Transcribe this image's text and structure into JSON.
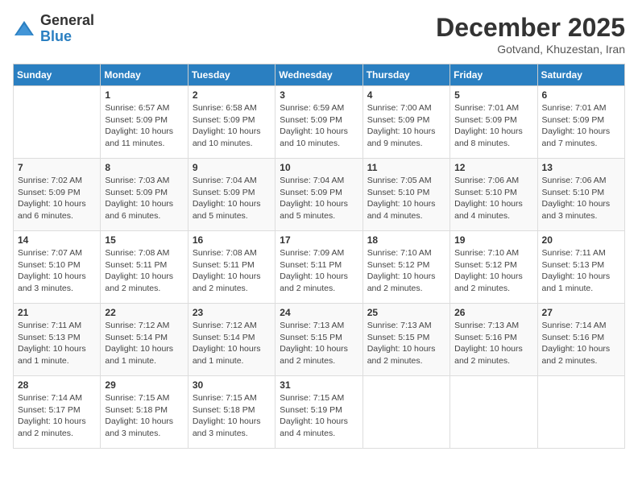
{
  "logo": {
    "general": "General",
    "blue": "Blue"
  },
  "header": {
    "month": "December 2025",
    "location": "Gotvand, Khuzestan, Iran"
  },
  "weekdays": [
    "Sunday",
    "Monday",
    "Tuesday",
    "Wednesday",
    "Thursday",
    "Friday",
    "Saturday"
  ],
  "weeks": [
    [
      {
        "day": "",
        "info": ""
      },
      {
        "day": "1",
        "info": "Sunrise: 6:57 AM\nSunset: 5:09 PM\nDaylight: 10 hours\nand 11 minutes."
      },
      {
        "day": "2",
        "info": "Sunrise: 6:58 AM\nSunset: 5:09 PM\nDaylight: 10 hours\nand 10 minutes."
      },
      {
        "day": "3",
        "info": "Sunrise: 6:59 AM\nSunset: 5:09 PM\nDaylight: 10 hours\nand 10 minutes."
      },
      {
        "day": "4",
        "info": "Sunrise: 7:00 AM\nSunset: 5:09 PM\nDaylight: 10 hours\nand 9 minutes."
      },
      {
        "day": "5",
        "info": "Sunrise: 7:01 AM\nSunset: 5:09 PM\nDaylight: 10 hours\nand 8 minutes."
      },
      {
        "day": "6",
        "info": "Sunrise: 7:01 AM\nSunset: 5:09 PM\nDaylight: 10 hours\nand 7 minutes."
      }
    ],
    [
      {
        "day": "7",
        "info": "Sunrise: 7:02 AM\nSunset: 5:09 PM\nDaylight: 10 hours\nand 6 minutes."
      },
      {
        "day": "8",
        "info": "Sunrise: 7:03 AM\nSunset: 5:09 PM\nDaylight: 10 hours\nand 6 minutes."
      },
      {
        "day": "9",
        "info": "Sunrise: 7:04 AM\nSunset: 5:09 PM\nDaylight: 10 hours\nand 5 minutes."
      },
      {
        "day": "10",
        "info": "Sunrise: 7:04 AM\nSunset: 5:09 PM\nDaylight: 10 hours\nand 5 minutes."
      },
      {
        "day": "11",
        "info": "Sunrise: 7:05 AM\nSunset: 5:10 PM\nDaylight: 10 hours\nand 4 minutes."
      },
      {
        "day": "12",
        "info": "Sunrise: 7:06 AM\nSunset: 5:10 PM\nDaylight: 10 hours\nand 4 minutes."
      },
      {
        "day": "13",
        "info": "Sunrise: 7:06 AM\nSunset: 5:10 PM\nDaylight: 10 hours\nand 3 minutes."
      }
    ],
    [
      {
        "day": "14",
        "info": "Sunrise: 7:07 AM\nSunset: 5:10 PM\nDaylight: 10 hours\nand 3 minutes."
      },
      {
        "day": "15",
        "info": "Sunrise: 7:08 AM\nSunset: 5:11 PM\nDaylight: 10 hours\nand 2 minutes."
      },
      {
        "day": "16",
        "info": "Sunrise: 7:08 AM\nSunset: 5:11 PM\nDaylight: 10 hours\nand 2 minutes."
      },
      {
        "day": "17",
        "info": "Sunrise: 7:09 AM\nSunset: 5:11 PM\nDaylight: 10 hours\nand 2 minutes."
      },
      {
        "day": "18",
        "info": "Sunrise: 7:10 AM\nSunset: 5:12 PM\nDaylight: 10 hours\nand 2 minutes."
      },
      {
        "day": "19",
        "info": "Sunrise: 7:10 AM\nSunset: 5:12 PM\nDaylight: 10 hours\nand 2 minutes."
      },
      {
        "day": "20",
        "info": "Sunrise: 7:11 AM\nSunset: 5:13 PM\nDaylight: 10 hours\nand 1 minute."
      }
    ],
    [
      {
        "day": "21",
        "info": "Sunrise: 7:11 AM\nSunset: 5:13 PM\nDaylight: 10 hours\nand 1 minute."
      },
      {
        "day": "22",
        "info": "Sunrise: 7:12 AM\nSunset: 5:14 PM\nDaylight: 10 hours\nand 1 minute."
      },
      {
        "day": "23",
        "info": "Sunrise: 7:12 AM\nSunset: 5:14 PM\nDaylight: 10 hours\nand 1 minute."
      },
      {
        "day": "24",
        "info": "Sunrise: 7:13 AM\nSunset: 5:15 PM\nDaylight: 10 hours\nand 2 minutes."
      },
      {
        "day": "25",
        "info": "Sunrise: 7:13 AM\nSunset: 5:15 PM\nDaylight: 10 hours\nand 2 minutes."
      },
      {
        "day": "26",
        "info": "Sunrise: 7:13 AM\nSunset: 5:16 PM\nDaylight: 10 hours\nand 2 minutes."
      },
      {
        "day": "27",
        "info": "Sunrise: 7:14 AM\nSunset: 5:16 PM\nDaylight: 10 hours\nand 2 minutes."
      }
    ],
    [
      {
        "day": "28",
        "info": "Sunrise: 7:14 AM\nSunset: 5:17 PM\nDaylight: 10 hours\nand 2 minutes."
      },
      {
        "day": "29",
        "info": "Sunrise: 7:15 AM\nSunset: 5:18 PM\nDaylight: 10 hours\nand 3 minutes."
      },
      {
        "day": "30",
        "info": "Sunrise: 7:15 AM\nSunset: 5:18 PM\nDaylight: 10 hours\nand 3 minutes."
      },
      {
        "day": "31",
        "info": "Sunrise: 7:15 AM\nSunset: 5:19 PM\nDaylight: 10 hours\nand 4 minutes."
      },
      {
        "day": "",
        "info": ""
      },
      {
        "day": "",
        "info": ""
      },
      {
        "day": "",
        "info": ""
      }
    ]
  ]
}
